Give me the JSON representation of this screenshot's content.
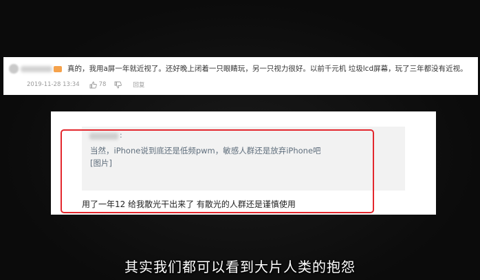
{
  "top_comment": {
    "badge_color": "#f5a24b",
    "text": "真的，我用a屏一年就近视了。还好晚上闭着一只眼睛玩，另一只视力很好。以前千元机 垃圾lcd屏幕，玩了三年都没有近视。",
    "date": "2019-11-28 13:34",
    "likes": "78",
    "reply_label": "回复"
  },
  "post": {
    "quote_colon": ":",
    "quote_lines": [
      "当然，iPhone说到底还是低频pwm，敏感人群还是放弃iPhone吧",
      "[图片]"
    ],
    "reply": "用了一年12 给我散光干出来了 有散光的人群还是谨慎使用"
  },
  "highlight_color": "#e3262c",
  "subtitle": "其实我们都可以看到大片人类的抱怨"
}
